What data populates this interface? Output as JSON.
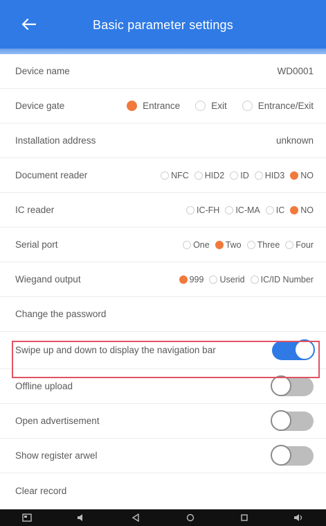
{
  "header": {
    "title": "Basic parameter settings"
  },
  "rows": {
    "device_name": {
      "label": "Device name",
      "value": "WD0001"
    },
    "device_gate": {
      "label": "Device gate",
      "options": [
        "Entrance",
        "Exit",
        "Entrance/Exit"
      ],
      "selected": "Entrance"
    },
    "installation_address": {
      "label": "Installation address",
      "value": "unknown"
    },
    "document_reader": {
      "label": "Document reader",
      "options": [
        "NFC",
        "HID2",
        "ID",
        "HID3",
        "NO"
      ],
      "selected": "NO"
    },
    "ic_reader": {
      "label": "IC reader",
      "options": [
        "IC-FH",
        "IC-MA",
        "IC",
        "NO"
      ],
      "selected": "NO"
    },
    "serial_port": {
      "label": "Serial port",
      "options": [
        "One",
        "Two",
        "Three",
        "Four"
      ],
      "selected": "Two"
    },
    "wiegand_output": {
      "label": "Wiegand output",
      "options": [
        "999",
        "Userid",
        "IC/ID Number"
      ],
      "selected": "999"
    },
    "change_password": {
      "label": "Change the password"
    },
    "swipe_nav": {
      "label": "Swipe up and down to display the navigation bar",
      "enabled": true
    },
    "offline_upload": {
      "label": "Offline upload",
      "enabled": false
    },
    "open_ad": {
      "label": "Open advertisement",
      "enabled": false
    },
    "show_register": {
      "label": "Show register arwel",
      "enabled": false
    },
    "next_row": {
      "label": "Clear record"
    }
  },
  "colors": {
    "accent": "#2f7ae5",
    "radio_selected": "#f0793b",
    "highlight": "#e05363"
  },
  "navbar": {
    "icons": [
      "screenshot-icon",
      "volume-down-icon",
      "back-icon",
      "home-icon",
      "recents-icon",
      "volume-up-icon"
    ]
  }
}
